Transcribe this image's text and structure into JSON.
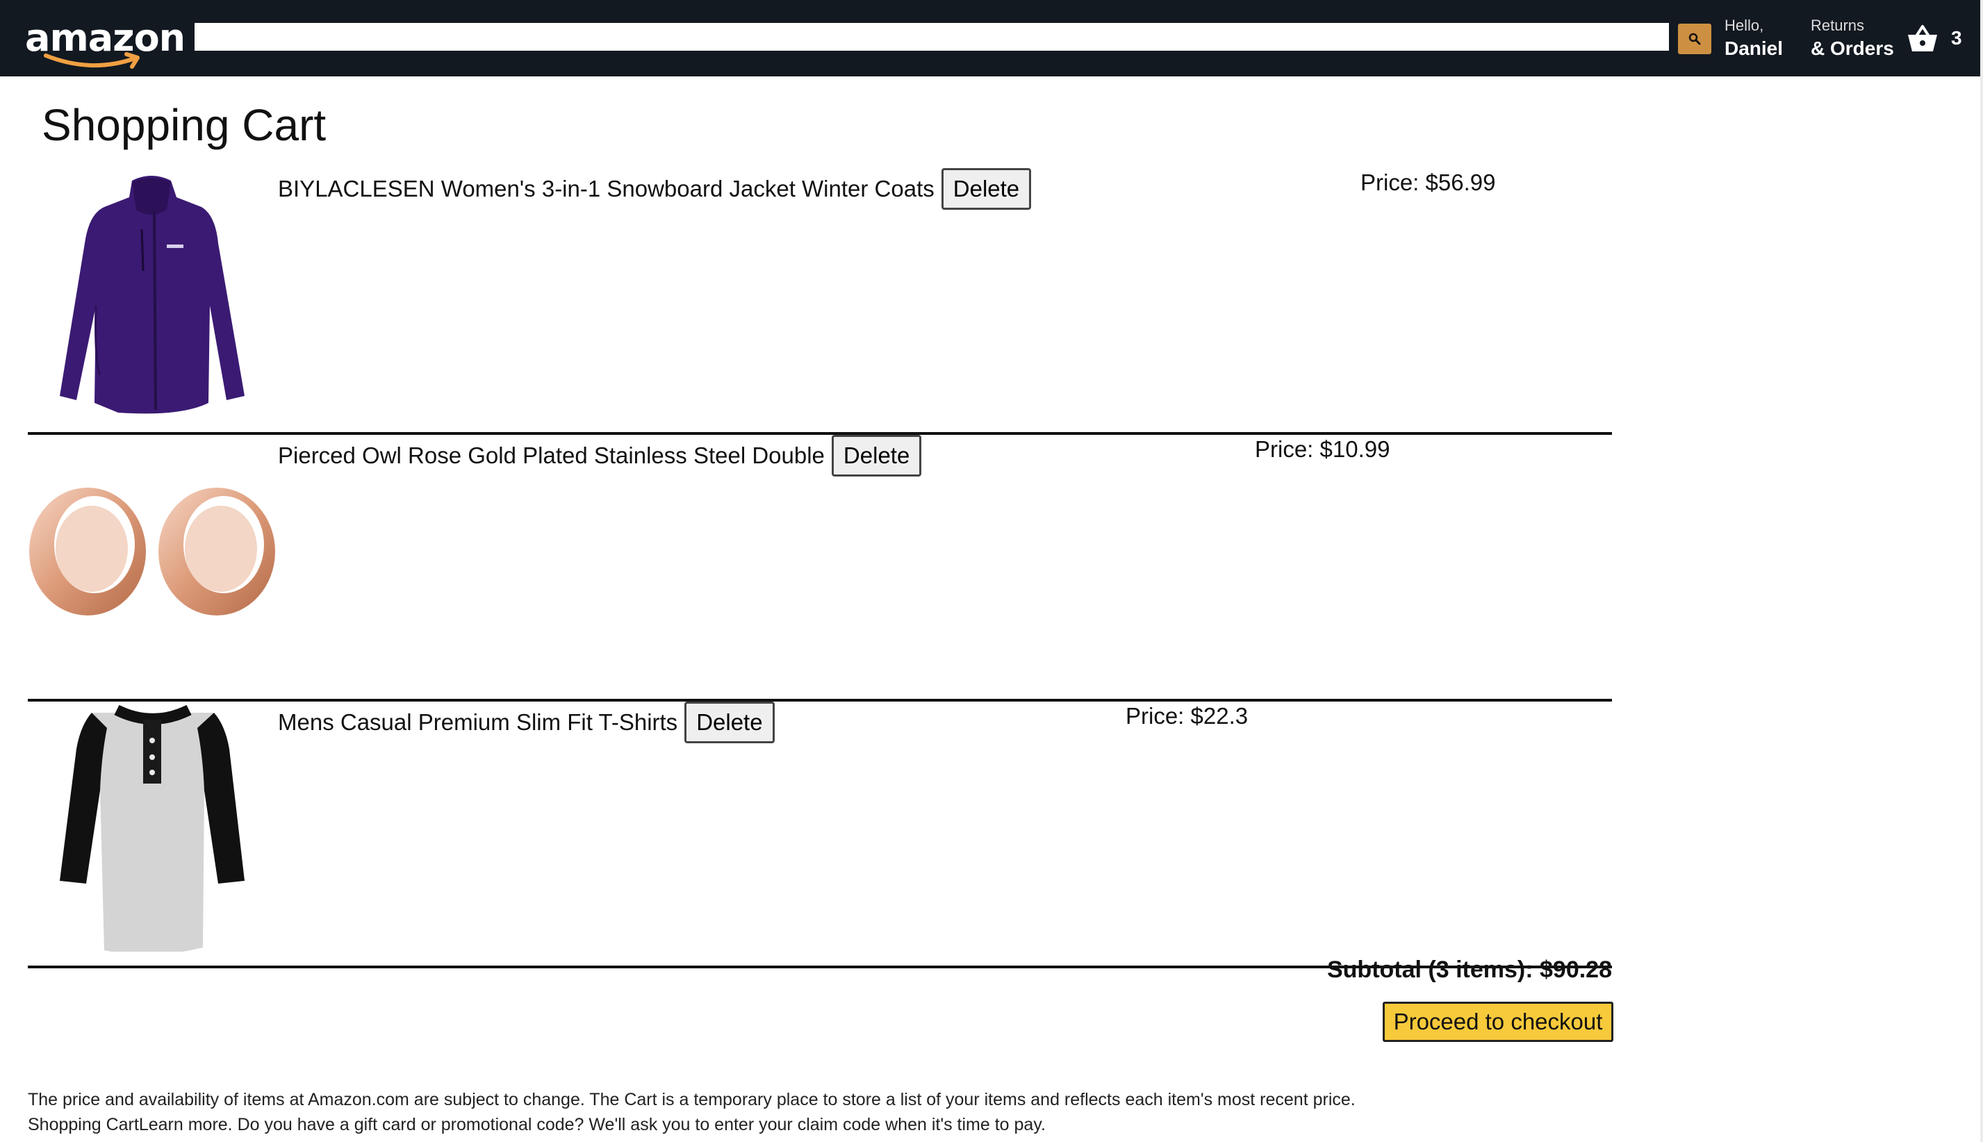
{
  "header": {
    "logo_text": "amazon",
    "search": {
      "value": "",
      "placeholder": ""
    },
    "account": {
      "greeting": "Hello,",
      "name": "Daniel"
    },
    "orders": {
      "line1": "Returns",
      "line2": "& Orders"
    },
    "cart": {
      "count": "3",
      "icon": "basket-icon"
    },
    "colors": {
      "bar": "#131921",
      "search_button": "#cd9042"
    }
  },
  "main": {
    "title": "Shopping Cart",
    "items": [
      {
        "title": "BIYLACLESEN Women's 3-in-1 Snowboard Jacket Winter Coats",
        "delete_label": "Delete",
        "price": "Price: $56.99",
        "image": "purple-jacket"
      },
      {
        "title": "Pierced Owl Rose Gold Plated Stainless Steel Double",
        "delete_label": "Delete",
        "price": "Price: $10.99",
        "image": "rose-gold-tunnels"
      },
      {
        "title": "Mens Casual Premium Slim Fit T-Shirts",
        "delete_label": "Delete",
        "price": "Price: $22.3",
        "image": "raglan-henley-shirt"
      }
    ],
    "subtotal": "Subtotal (3 items): $90.28",
    "checkout_label": "Proceed to checkout",
    "disclaimer": "The price and availability of items at Amazon.com are subject to change. The Cart is a temporary place to store a list of your items and reflects each item's most recent price. Shopping CartLearn more. Do you have a gift card or promotional code? We'll ask you to enter your claim code when it's time to pay."
  },
  "colors": {
    "checkout_button": "#f7ca3b",
    "jacket": "#3b1a73"
  }
}
